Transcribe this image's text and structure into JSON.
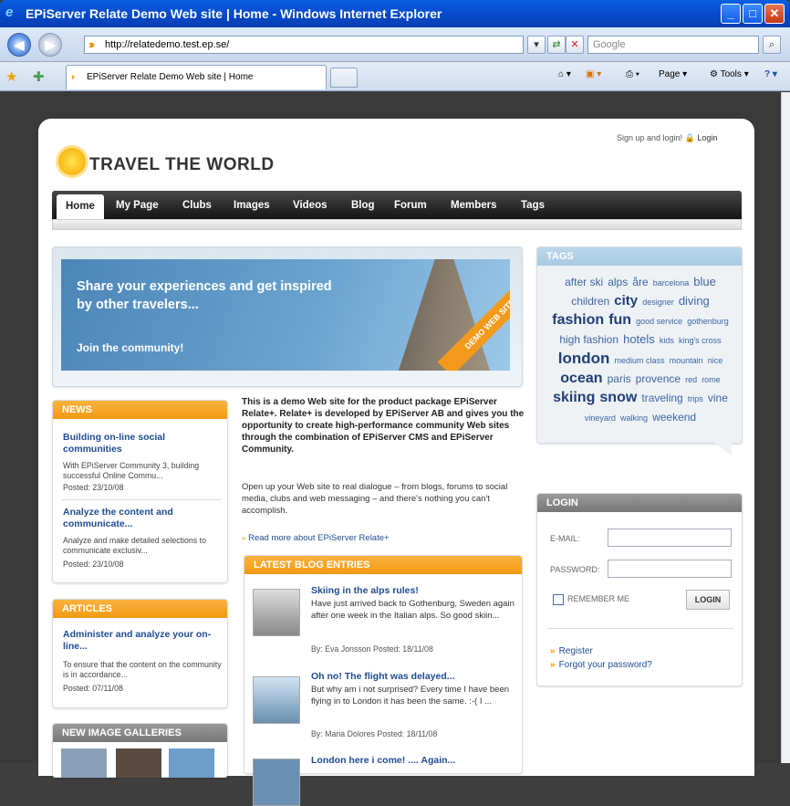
{
  "window": {
    "title": "EPiServer Relate Demo Web site | Home - Windows Internet Explorer",
    "min": "_",
    "max": "□",
    "close": "✕"
  },
  "browser": {
    "address": "http://relatedemo.test.ep.se/",
    "search_placeholder": "Google",
    "tab_title": "EPiServer Relate Demo Web site | Home",
    "page_menu": "Page",
    "tools_menu": "Tools"
  },
  "site": {
    "logo": "TRAVEL THE WORLD",
    "signup": "Sign up and login!",
    "login_link": "Login",
    "nav": [
      {
        "label": "Home"
      },
      {
        "label": "My Page"
      },
      {
        "label": "Clubs"
      },
      {
        "label": "Images"
      },
      {
        "label": "Videos"
      },
      {
        "label": "Blog"
      },
      {
        "label": "Forum"
      },
      {
        "label": "Members"
      },
      {
        "label": "Tags"
      }
    ],
    "hero": {
      "headline": "Share your experiences and get inspired by other travelers...",
      "cta": "Join the community!",
      "ribbon": "DEMO WEB SITE"
    },
    "news": {
      "title": "NEWS",
      "items": [
        {
          "title": "Building on-line social communities",
          "text": "With EPiServer Community 3, building successful Online Commu...",
          "posted": "Posted: 23/10/08"
        },
        {
          "title": "Analyze the content and communicate...",
          "text": "Analyze and make detailed selections to communicate exclusiv...",
          "posted": "Posted: 23/10/08"
        }
      ]
    },
    "articles": {
      "title": "ARTICLES",
      "items": [
        {
          "title": "Administer and analyze your on-line...",
          "text": "To ensure that the content on the community is in accordance...",
          "posted": "Posted: 07/11/08"
        }
      ]
    },
    "galleries": {
      "title": "NEW IMAGE GALLERIES"
    },
    "intro": "This is a demo Web site for the product package EPiServer Relate+. Relate+ is developed by EPiServer AB and gives you the opportunity to create high-performance community Web sites through the combination of EPiServer CMS and EPiServer Community.",
    "intro2": "Open up your Web site to real dialogue – from blogs, forums to social media,  clubs and web messaging – and there's nothing you can't accomplish.",
    "readmore": "Read more about EPiServer Relate+",
    "blog": {
      "title": "LATEST BLOG ENTRIES",
      "items": [
        {
          "title": "Skiing in the alps rules!",
          "text": "Have just arrived back to Gothenburg, Sweden again after one week in the Italian alps. So good skiin...",
          "meta": "By: Eva Jonsson    Posted: 18/11/08"
        },
        {
          "title": "Oh no! The flight was delayed...",
          "text": "But why am i not surprised? Every time I have been flying in to London it has been the same. :-( I ...",
          "meta": "By: Maria Dolores    Posted: 18/11/08"
        },
        {
          "title": "London here i come! .... Again...",
          "text": "",
          "meta": ""
        }
      ]
    },
    "tags": {
      "title": "TAGS",
      "cloud": [
        {
          "t": "after ski",
          "s": 12
        },
        {
          "t": "alps",
          "s": 12
        },
        {
          "t": "åre",
          "s": 12
        },
        {
          "t": "barcelona",
          "s": 9
        },
        {
          "t": "blue",
          "s": 13
        },
        {
          "t": "children",
          "s": 12
        },
        {
          "t": "city",
          "s": 15,
          "b": true
        },
        {
          "t": "designer",
          "s": 9
        },
        {
          "t": "diving",
          "s": 13
        },
        {
          "t": "fashion",
          "s": 16,
          "b": true
        },
        {
          "t": "fun",
          "s": 16,
          "b": true
        },
        {
          "t": "good service",
          "s": 9
        },
        {
          "t": "gothenburg",
          "s": 9
        },
        {
          "t": "high fashion",
          "s": 12
        },
        {
          "t": "hotels",
          "s": 13
        },
        {
          "t": "kids",
          "s": 9
        },
        {
          "t": "king's cross",
          "s": 9
        },
        {
          "t": "london",
          "s": 17,
          "b": true
        },
        {
          "t": "medium class",
          "s": 9
        },
        {
          "t": "mountain",
          "s": 9
        },
        {
          "t": "nice",
          "s": 9
        },
        {
          "t": "ocean",
          "s": 16,
          "b": true
        },
        {
          "t": "paris",
          "s": 12
        },
        {
          "t": "provence",
          "s": 12
        },
        {
          "t": "red",
          "s": 9
        },
        {
          "t": "rome",
          "s": 9
        },
        {
          "t": "skiing",
          "s": 16,
          "b": true
        },
        {
          "t": "snow",
          "s": 16,
          "b": true
        },
        {
          "t": "traveling",
          "s": 12
        },
        {
          "t": "trips",
          "s": 9
        },
        {
          "t": "vine",
          "s": 12
        },
        {
          "t": "vineyard",
          "s": 9
        },
        {
          "t": "walking",
          "s": 9
        },
        {
          "t": "weekend",
          "s": 12
        }
      ]
    },
    "login": {
      "title": "LOGIN",
      "email_label": "E-MAIL:",
      "password_label": "PASSWORD:",
      "remember": "REMEMBER ME",
      "button": "LOGIN",
      "register": "Register",
      "forgot": "Forgot your password?"
    }
  }
}
